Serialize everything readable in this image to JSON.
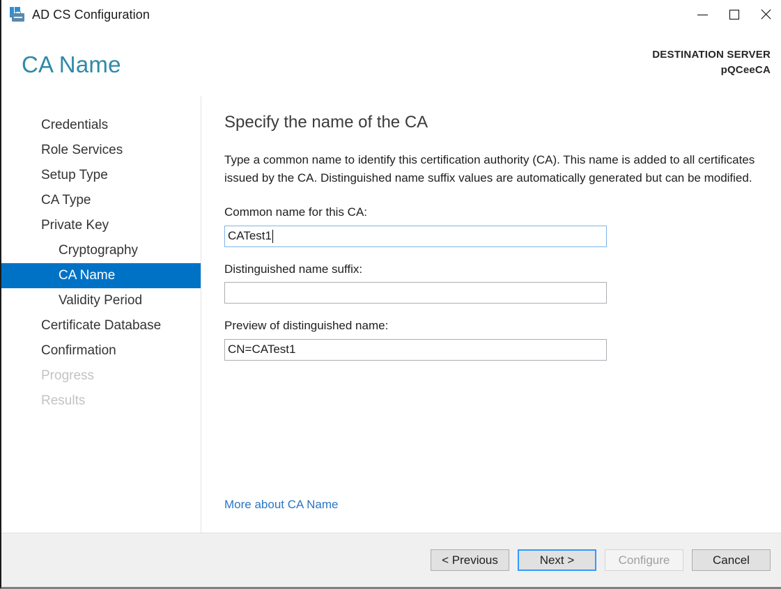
{
  "window": {
    "title": "AD CS Configuration",
    "icon": "adcs-configuration-icon",
    "controls": {
      "minimize": "—",
      "maximize": "□",
      "close": "✕"
    }
  },
  "header": {
    "page_title": "CA Name",
    "destination_label": "DESTINATION SERVER",
    "destination_value": "pQCeeCA",
    "title_color": "#2e8aa8"
  },
  "sidebar": {
    "items": [
      {
        "label": "Credentials",
        "state": "normal",
        "indent": false
      },
      {
        "label": "Role Services",
        "state": "normal",
        "indent": false
      },
      {
        "label": "Setup Type",
        "state": "normal",
        "indent": false
      },
      {
        "label": "CA Type",
        "state": "normal",
        "indent": false
      },
      {
        "label": "Private Key",
        "state": "normal",
        "indent": false
      },
      {
        "label": "Cryptography",
        "state": "normal",
        "indent": true
      },
      {
        "label": "CA Name",
        "state": "selected",
        "indent": true
      },
      {
        "label": "Validity Period",
        "state": "normal",
        "indent": true
      },
      {
        "label": "Certificate Database",
        "state": "normal",
        "indent": false
      },
      {
        "label": "Confirmation",
        "state": "normal",
        "indent": false
      },
      {
        "label": "Progress",
        "state": "disabled",
        "indent": false
      },
      {
        "label": "Results",
        "state": "disabled",
        "indent": false
      }
    ],
    "selected_color": "#0072c6"
  },
  "main": {
    "heading": "Specify the name of the CA",
    "description": "Type a common name to identify this certification authority (CA). This name is added to all certificates issued by the CA. Distinguished name suffix values are automatically generated but can be modified.",
    "fields": {
      "common_name": {
        "label": "Common name for this CA:",
        "value": "CATest1",
        "placeholder": "",
        "focused": true
      },
      "dn_suffix": {
        "label": "Distinguished name suffix:",
        "value": "",
        "placeholder": "",
        "focused": false
      },
      "dn_preview": {
        "label": "Preview of distinguished name:",
        "value": "CN=CATest1",
        "placeholder": "",
        "focused": false,
        "readonly": true
      }
    },
    "more_link": "More about CA Name",
    "link_color": "#2a76c6"
  },
  "footer": {
    "buttons": [
      {
        "label": "< Previous",
        "state": "normal"
      },
      {
        "label": "Next >",
        "state": "default"
      },
      {
        "label": "Configure",
        "state": "disabled"
      },
      {
        "label": "Cancel",
        "state": "normal"
      }
    ]
  }
}
